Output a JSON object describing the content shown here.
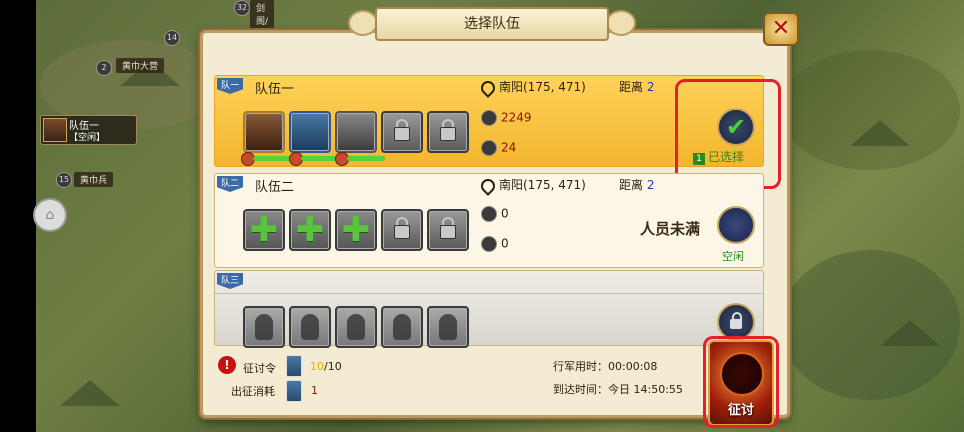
{
  "dialog": {
    "title": "选择队伍",
    "close_glyph": "✕"
  },
  "map_hud": {
    "top_badge_num": "32",
    "top_label": "剑阁/刘雅士",
    "badge_2": "2",
    "label_camp": "黄巾大营",
    "badge_14": "14",
    "badge_15": "15",
    "label_soldiers": "黄巾兵",
    "squad_name": "队伍一",
    "squad_status": "【空闲】"
  },
  "teams": [
    {
      "tag": "队一",
      "name": "队伍一",
      "location": "南阳(175, 471)",
      "distance_label": "距离",
      "distance": "2",
      "troops": "2249",
      "speed": "24",
      "status_count": "1",
      "status_text": "已选择",
      "hp_fill": [
        1.0,
        1.0,
        1.0
      ]
    },
    {
      "tag": "队二",
      "name": "队伍二",
      "location": "南阳(175, 471)",
      "distance_label": "距离",
      "distance": "2",
      "troops": "0",
      "speed": "0",
      "not_full_text": "人员未满",
      "status_text": "空闲"
    },
    {
      "tag": "队三"
    }
  ],
  "footer": {
    "campaign_order_label": "征讨令",
    "campaign_order_current": "10",
    "campaign_order_max": "/10",
    "expedition_cost_label": "出征消耗",
    "expedition_cost": "1",
    "march_time_label": "行军用时：",
    "march_time": "00:00:08",
    "arrival_label": "到达时间：",
    "arrival_time": "今日 14:50:55",
    "campaign_button": "征讨",
    "warn_glyph": "!"
  },
  "icons": {
    "check": "✔",
    "plus": "✚"
  },
  "colors": {
    "selected_row": "#f3b62e",
    "highlight": "#e4202a",
    "ok_green": "#44d82a"
  }
}
